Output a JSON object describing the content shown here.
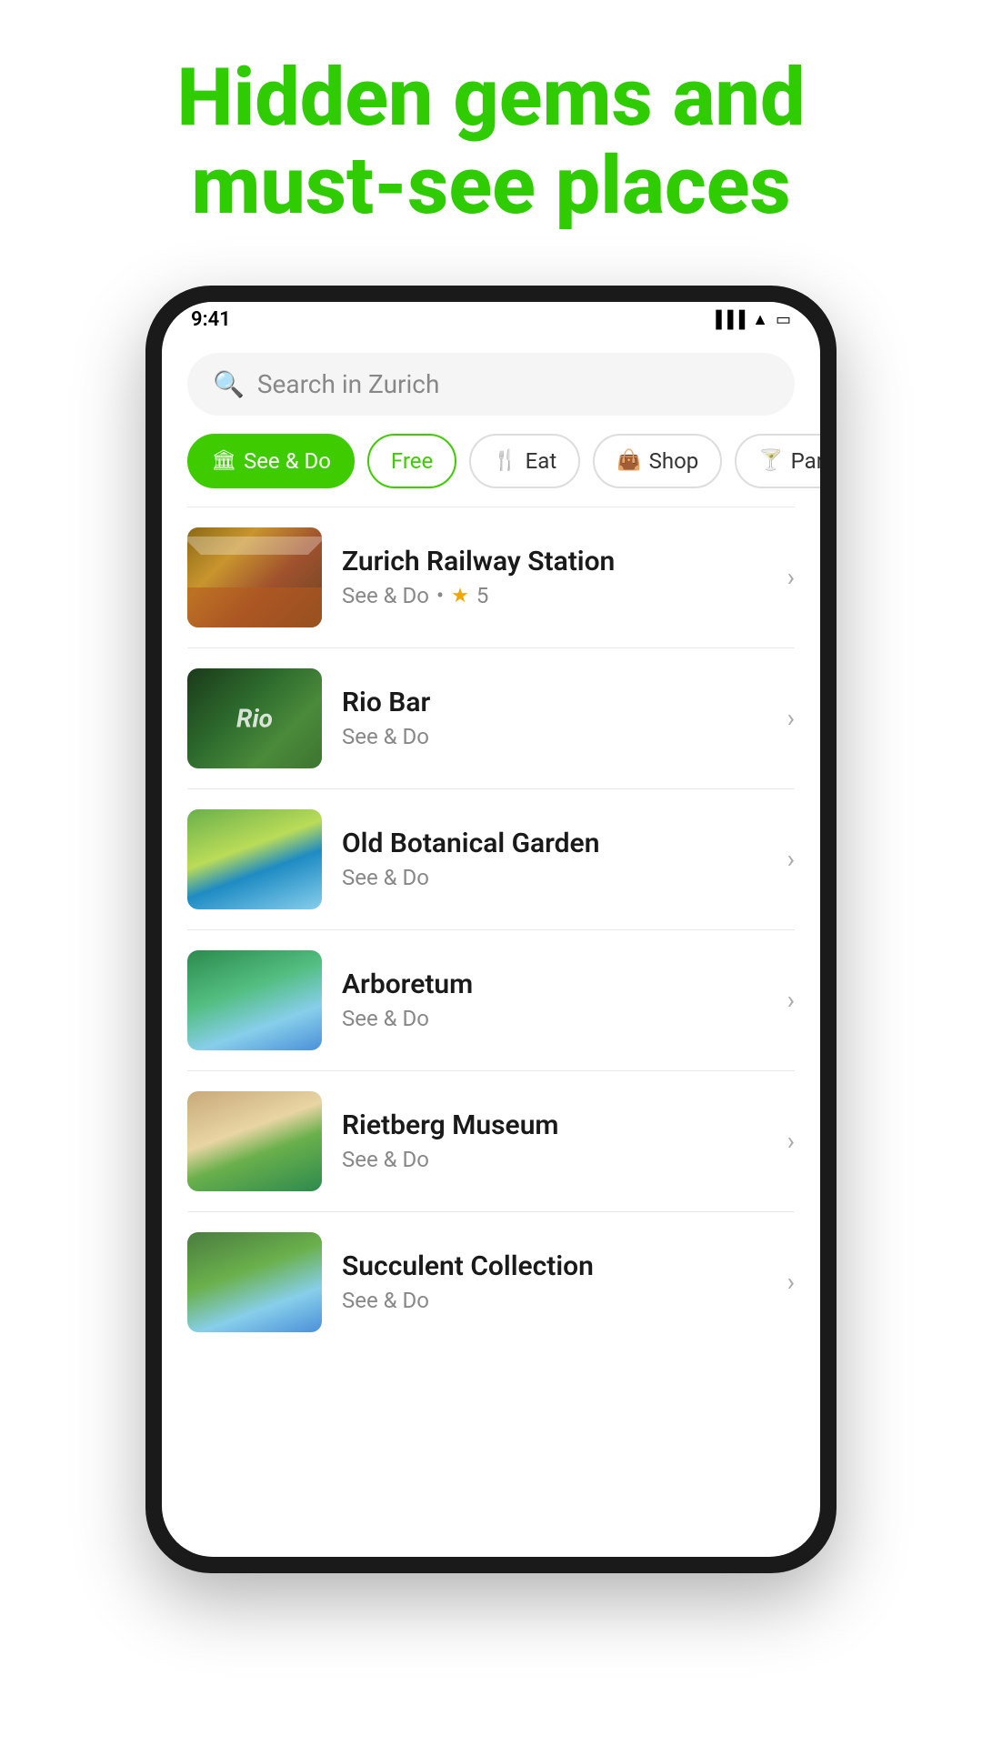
{
  "header": {
    "title_line1": "Hidden gems and",
    "title_line2": "must-see places"
  },
  "search": {
    "placeholder": "Search in Zurich"
  },
  "filters": [
    {
      "id": "see-do",
      "label": "See & Do",
      "icon": "🏛",
      "active": true
    },
    {
      "id": "free",
      "label": "Free",
      "icon": "",
      "active": true
    },
    {
      "id": "eat",
      "label": "Eat",
      "icon": "🍴",
      "active": false
    },
    {
      "id": "shop",
      "label": "Shop",
      "icon": "👜",
      "active": false
    },
    {
      "id": "party",
      "label": "Party",
      "icon": "🍸",
      "active": false
    }
  ],
  "places": [
    {
      "id": "zurich-railway-station",
      "name": "Zurich Railway Station",
      "category": "See & Do",
      "rating": 5,
      "has_rating": true,
      "thumb_class": "thumb-railway"
    },
    {
      "id": "rio-bar",
      "name": "Rio Bar",
      "category": "See & Do",
      "has_rating": false,
      "thumb_class": "thumb-riobar"
    },
    {
      "id": "old-botanical-garden",
      "name": "Old Botanical Garden",
      "category": "See & Do",
      "has_rating": false,
      "thumb_class": "thumb-botanical"
    },
    {
      "id": "arboretum",
      "name": "Arboretum",
      "category": "See & Do",
      "has_rating": false,
      "thumb_class": "thumb-arboretum"
    },
    {
      "id": "rietberg-museum",
      "name": "Rietberg Museum",
      "category": "See & Do",
      "has_rating": false,
      "thumb_class": "thumb-rietberg"
    },
    {
      "id": "succulent-collection",
      "name": "Succulent Collection",
      "category": "See & Do",
      "has_rating": false,
      "thumb_class": "thumb-succulent"
    }
  ],
  "status_bar": {
    "time": "9:41"
  }
}
